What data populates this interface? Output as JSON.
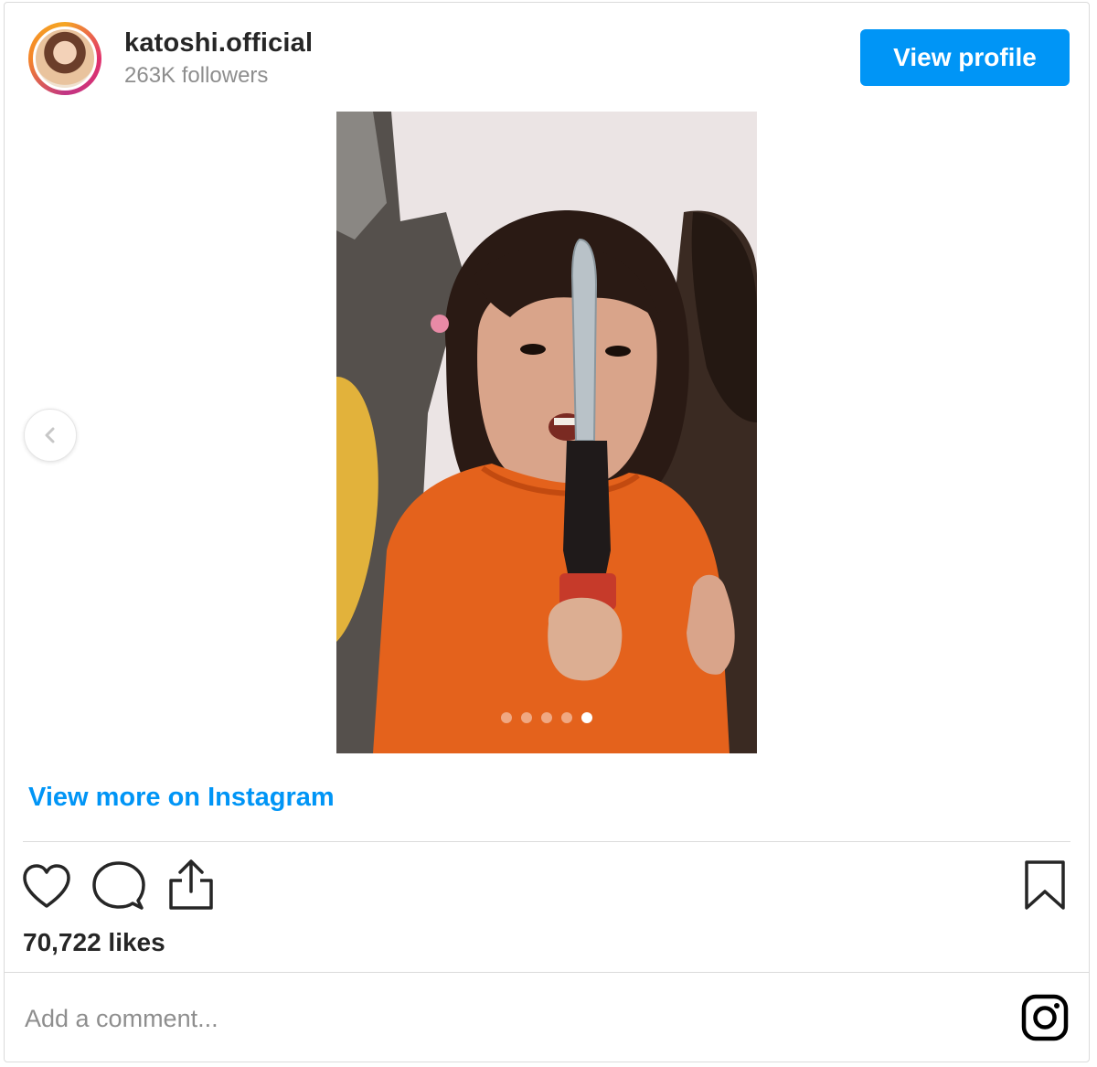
{
  "header": {
    "username": "katoshi.official",
    "followers": "263K followers",
    "view_profile_label": "View profile"
  },
  "carousel": {
    "slide_count": 5,
    "active_index": 4
  },
  "view_more_label": "View more on Instagram",
  "likes": "70,722 likes",
  "comment": {
    "placeholder": "Add a comment..."
  },
  "colors": {
    "accent_blue": "#0095f6",
    "text_primary": "#262626",
    "text_secondary": "#8e8e8e",
    "border": "#dbdbdb"
  },
  "icons": {
    "like": "heart-icon",
    "comment": "comment-bubble-icon",
    "share": "share-icon",
    "save": "bookmark-icon",
    "instagram": "instagram-logo-icon",
    "prev": "chevron-left-icon"
  }
}
